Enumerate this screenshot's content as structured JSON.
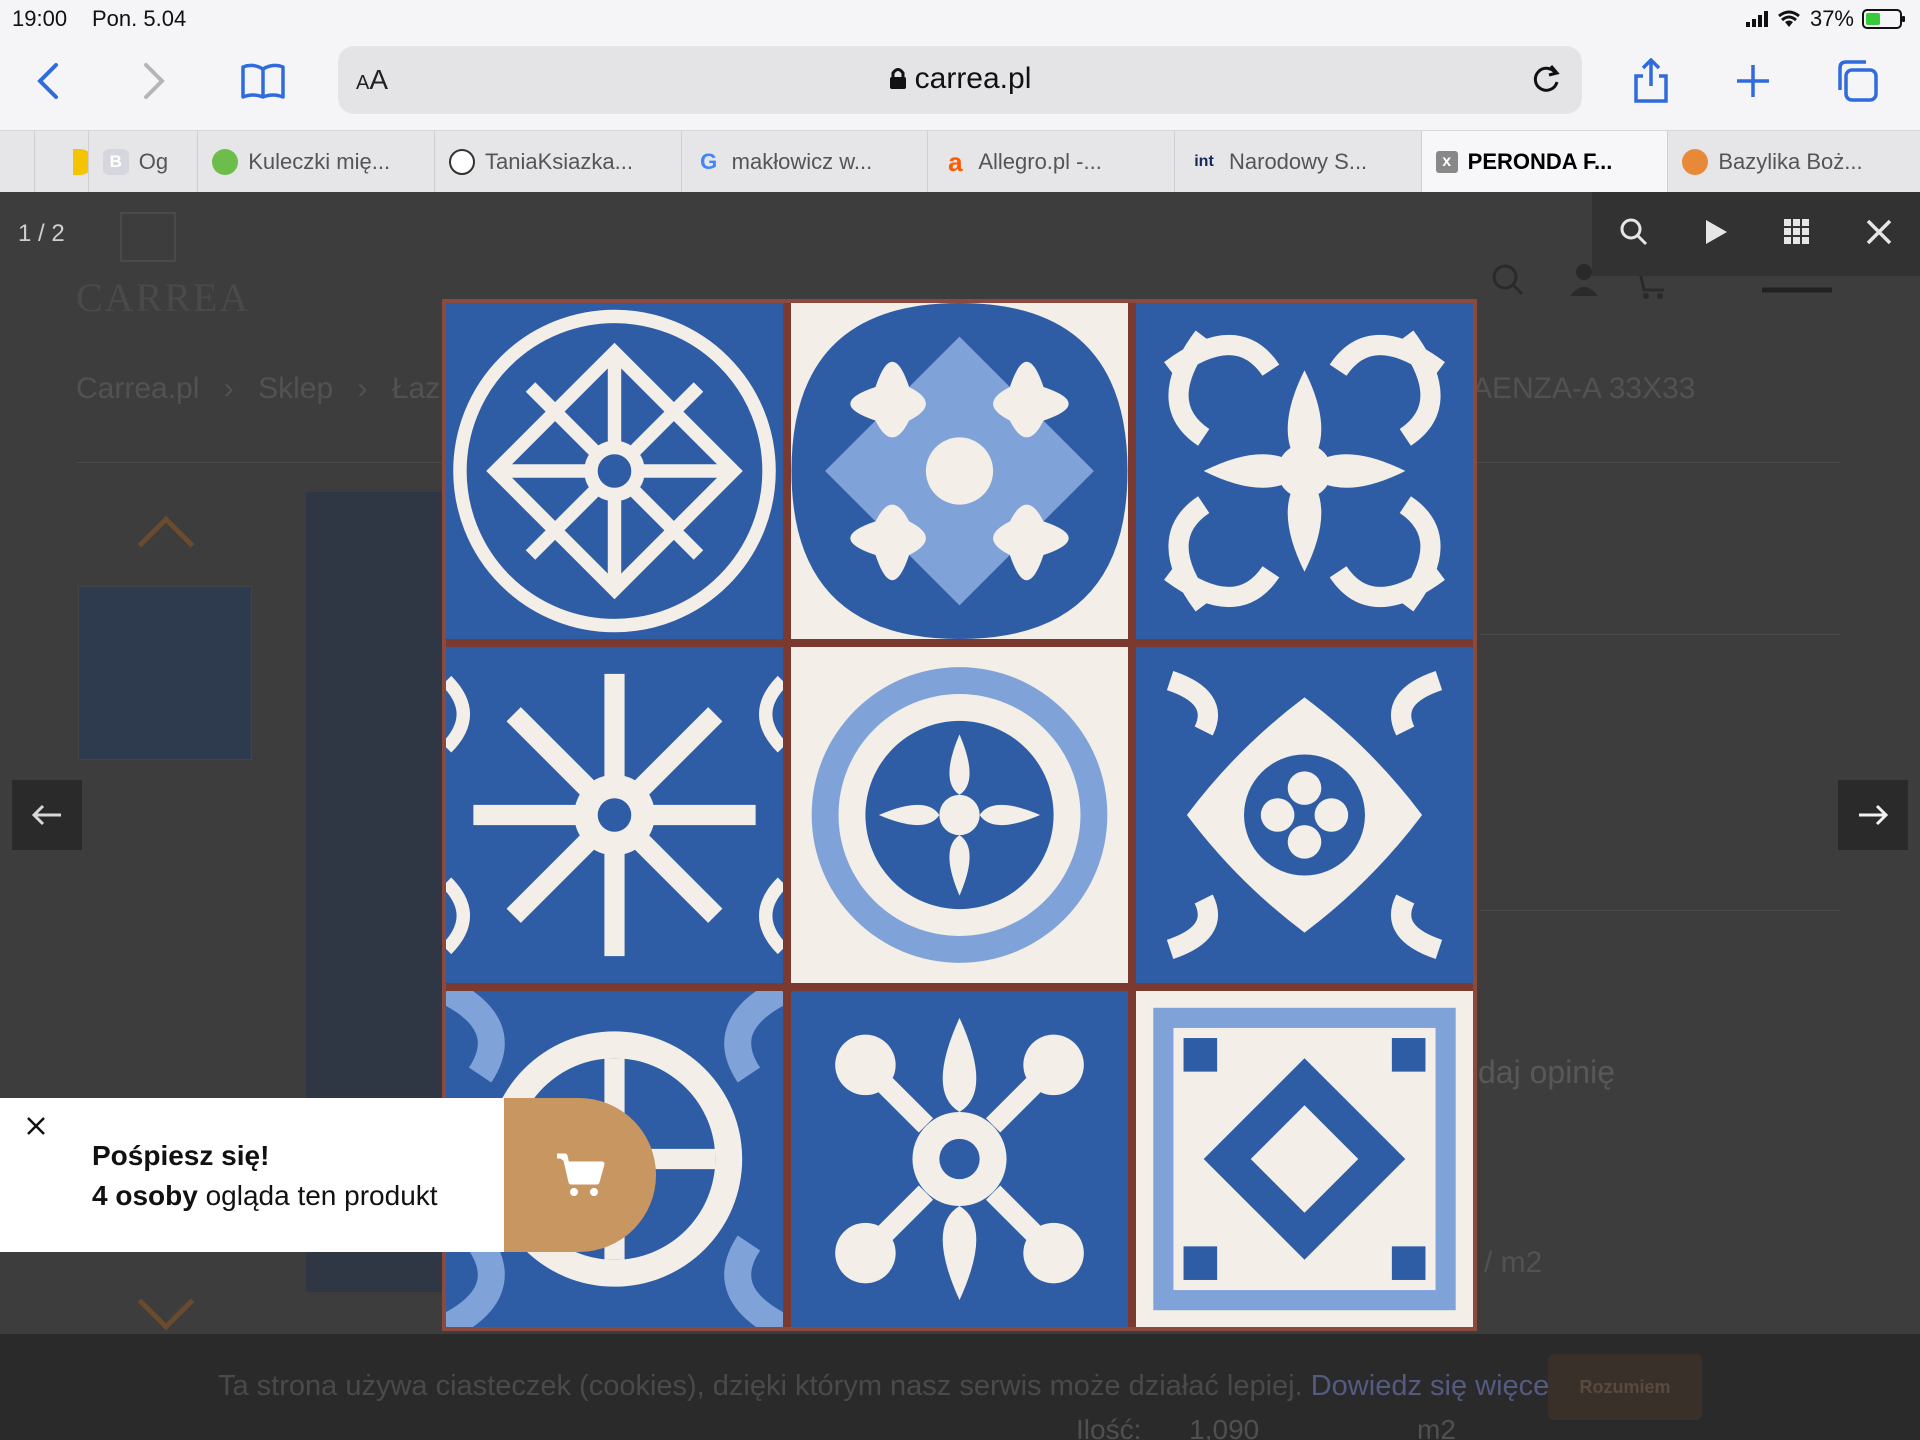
{
  "status_bar": {
    "time": "19:00",
    "date": "Pon. 5.04",
    "battery": "37%"
  },
  "browser": {
    "address_prefix": "AA",
    "url": "carrea.pl",
    "tabs": [
      {
        "label": "Og",
        "favicon": "B"
      },
      {
        "label": "Kuleczki mię...",
        "favicon": ""
      },
      {
        "label": "TaniaKsiazka...",
        "favicon": ""
      },
      {
        "label": "makłowicz w...",
        "favicon": "G"
      },
      {
        "label": "Allegro.pl -...",
        "favicon": "a"
      },
      {
        "label": "Narodowy S...",
        "favicon": "int"
      },
      {
        "label": "PERONDA F...",
        "favicon": "x",
        "active": true
      },
      {
        "label": "Bazylika Boż...",
        "favicon": ""
      }
    ]
  },
  "page": {
    "logo": "CARREA",
    "breadcrumb": [
      "Carrea.pl",
      "Sklep",
      "Łaz"
    ],
    "breadcrumb_tail": "AENZA-A 33X33",
    "review_link": "daj opinię",
    "price_unit": "/ m2"
  },
  "lightbox": {
    "counter": "1 / 2"
  },
  "toast": {
    "title": "Pośpiesz się!",
    "count": "4 osoby",
    "text": " ogląda ten produkt"
  },
  "cookie": {
    "text": "Ta strona używa ciasteczek (cookies), dzięki którym nasz serwis może działać lepiej.",
    "link": "Dowiedz się więcej",
    "button": "Rozumiem",
    "qty_label": "Ilość:",
    "qty_value": "1,090",
    "qty_unit": "m2"
  },
  "colors": {
    "tile_blue": "#2f5da5",
    "tile_light": "#7fa3d9",
    "accent": "#c89661",
    "link": "#2f6bdc"
  }
}
